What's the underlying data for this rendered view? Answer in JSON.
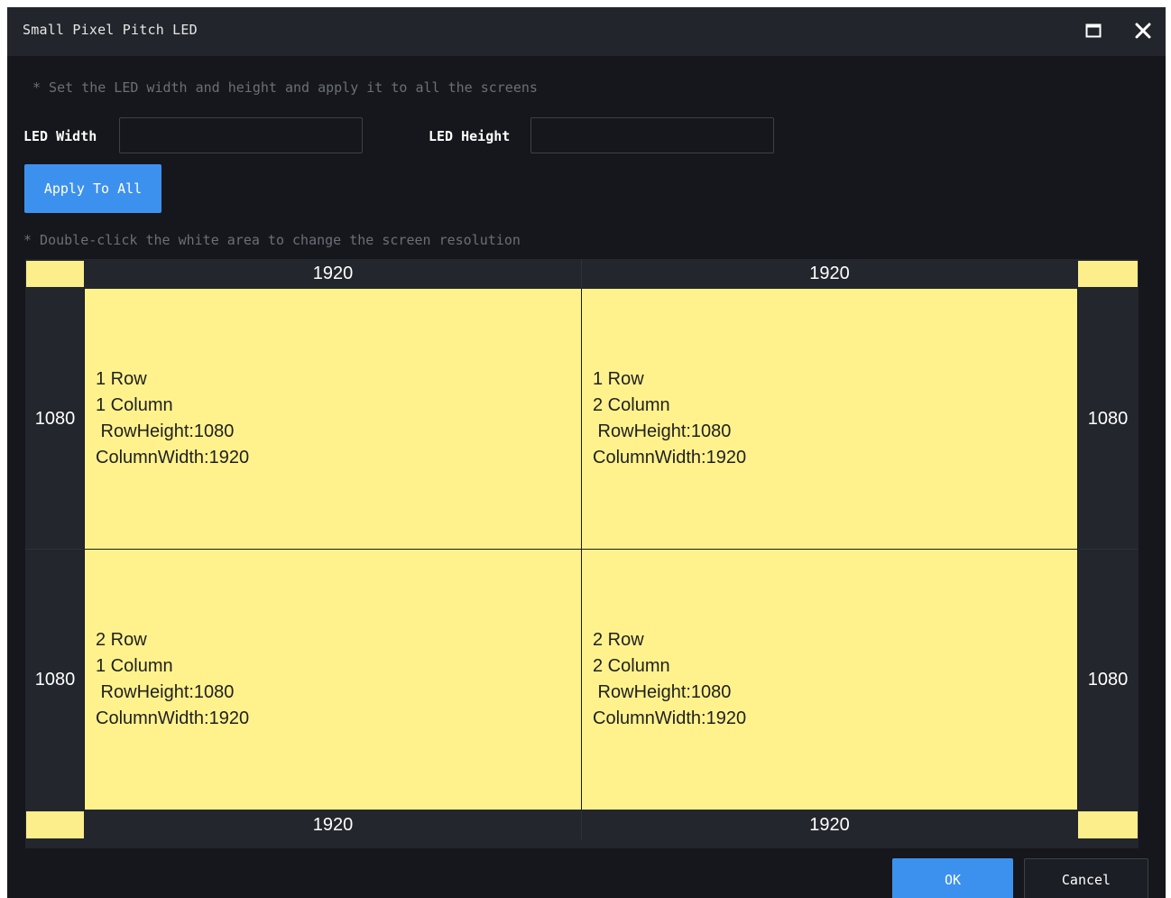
{
  "window": {
    "title": "Small Pixel Pitch LED",
    "maximize_icon": "maximize-icon",
    "close_icon": "close-icon"
  },
  "hints": {
    "top": "* Set the LED width and height and apply it to all the screens",
    "grid": "* Double-click the white area to change the screen resolution"
  },
  "form": {
    "width_label": "LED Width",
    "width_value": "",
    "height_label": "LED Height",
    "height_value": "",
    "apply_label": "Apply To All"
  },
  "grid": {
    "top_widths": [
      "1920",
      "1920"
    ],
    "bottom_widths": [
      "1920",
      "1920"
    ],
    "left_heights": [
      "1080",
      "1080"
    ],
    "right_heights": [
      "1080",
      "1080"
    ],
    "cells": [
      {
        "row_label": "1 Row",
        "column_label": "1 Column",
        "row_height": " RowHeight:1080",
        "column_width": "ColumnWidth:1920"
      },
      {
        "row_label": "1 Row",
        "column_label": "2 Column",
        "row_height": " RowHeight:1080",
        "column_width": "ColumnWidth:1920"
      },
      {
        "row_label": "2 Row",
        "column_label": "1 Column",
        "row_height": " RowHeight:1080",
        "column_width": "ColumnWidth:1920"
      },
      {
        "row_label": "2 Row",
        "column_label": "2 Column",
        "row_height": " RowHeight:1080",
        "column_width": "ColumnWidth:1920"
      }
    ],
    "cell_color": "#fff28d",
    "header_color": "#23262d"
  },
  "footer": {
    "ok_label": "OK",
    "cancel_label": "Cancel"
  },
  "colors": {
    "accent": "#3d91ee",
    "background": "#15171c"
  }
}
